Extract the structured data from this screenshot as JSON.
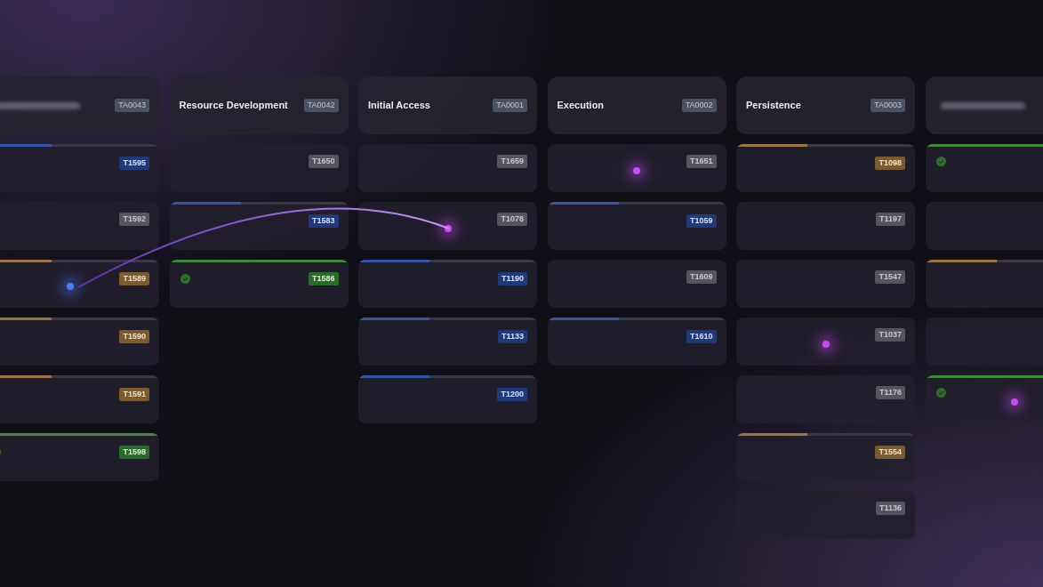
{
  "connection": true,
  "columns": [
    {
      "title_blurred": true,
      "code": "TA0043",
      "cards": [
        {
          "code": "T1595",
          "kind": "active",
          "level": 0.4
        },
        {
          "code": "T1592",
          "kind": "none"
        },
        {
          "code": "T1589",
          "kind": "partial",
          "level": 0.4,
          "color": "#4d7bff"
        },
        {
          "code": "T1590",
          "kind": "partial",
          "level": 0.4
        },
        {
          "code": "T1591",
          "kind": "partial",
          "level": 0.4
        },
        {
          "code": "T1598",
          "kind": "done",
          "level": 1
        }
      ]
    },
    {
      "title": "Resource Development",
      "code": "TA0042",
      "cards": [
        {
          "code": "T1650",
          "kind": "none"
        },
        {
          "code": "T1583",
          "kind": "active",
          "level": 0.4
        },
        {
          "code": "T1586",
          "kind": "done",
          "level": 1
        }
      ]
    },
    {
      "title": "Initial Access",
      "code": "TA0001",
      "cards": [
        {
          "code": "T1659",
          "kind": "none"
        },
        {
          "code": "T1078",
          "kind": "none",
          "color": "#d048ff"
        },
        {
          "code": "T1190",
          "kind": "active",
          "level": 0.4
        },
        {
          "code": "T1133",
          "kind": "active",
          "level": 0.4
        },
        {
          "code": "T1200",
          "kind": "active",
          "level": 0.4
        }
      ]
    },
    {
      "title": "Execution",
      "code": "TA0002",
      "cards": [
        {
          "code": "T1651",
          "kind": "none",
          "color": "#c54cf5"
        },
        {
          "code": "T1059",
          "kind": "active",
          "level": 0.4
        },
        {
          "code": "T1609",
          "kind": "none"
        },
        {
          "code": "T1610",
          "kind": "active",
          "level": 0.4
        }
      ]
    },
    {
      "title": "Persistence",
      "code": "TA0003",
      "cards": [
        {
          "code": "T1098",
          "kind": "partial",
          "level": 0.4
        },
        {
          "code": "T1197",
          "kind": "none"
        },
        {
          "code": "T1547",
          "kind": "none"
        },
        {
          "code": "T1037",
          "kind": "none",
          "color": "#c54cf5"
        },
        {
          "code": "T1176",
          "kind": "none"
        },
        {
          "code": "T1554",
          "kind": "partial",
          "level": 0.4
        },
        {
          "code": "T1136",
          "kind": "none"
        }
      ]
    },
    {
      "title_blurred": true,
      "cards": [
        {
          "kind": "done",
          "level": 1
        },
        {
          "kind": "none"
        },
        {
          "kind": "partial",
          "level": 0.4
        },
        {
          "kind": "none"
        },
        {
          "kind": "done",
          "level": 1,
          "color": "#c54cf5"
        }
      ]
    }
  ]
}
